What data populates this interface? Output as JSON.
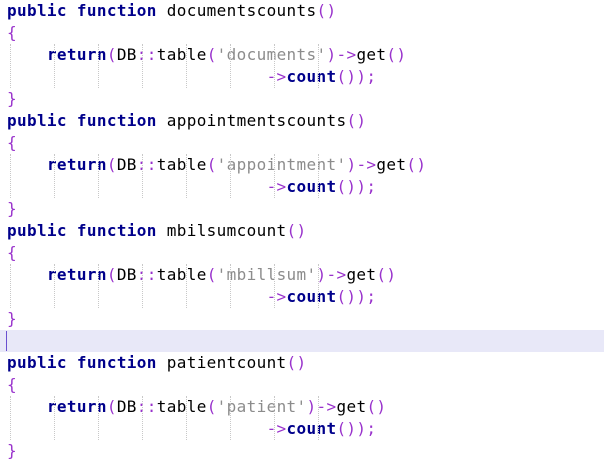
{
  "colors": {
    "background": "#ffffff",
    "keyword": "#00008b",
    "bracket_operator": "#9932cc",
    "string": "#8c8c8c",
    "current_line": "#e8e8f8"
  },
  "lines": [
    {
      "kw1": "public",
      "kw2": "function",
      "name": "documentscounts",
      "paren": "()"
    },
    {
      "brace": "{"
    },
    {
      "ret": "return",
      "p1": "(",
      "db": "DB",
      "sep": "::",
      "tbl": "table",
      "p2": "(",
      "str": "'documents'",
      "p3": ")",
      "arrow": "->",
      "get": "get",
      "p4": "()"
    },
    {
      "arrow": "->",
      "count": "count",
      "tail": "());"
    },
    {
      "brace": "}"
    },
    {
      "kw1": "public",
      "kw2": "function",
      "name": "appointmentscounts",
      "paren": "()"
    },
    {
      "brace": "{"
    },
    {
      "ret": "return",
      "p1": "(",
      "db": "DB",
      "sep": "::",
      "tbl": "table",
      "p2": "(",
      "str": "'appointment'",
      "p3": ")",
      "arrow": "->",
      "get": "get",
      "p4": "()"
    },
    {
      "arrow": "->",
      "count": "count",
      "tail": "());"
    },
    {
      "brace": "}"
    },
    {
      "kw1": "public",
      "kw2": "function",
      "name": "mbilsumcount",
      "paren": "()"
    },
    {
      "brace": "{"
    },
    {
      "ret": "return",
      "p1": "(",
      "db": "DB",
      "sep": "::",
      "tbl": "table",
      "p2": "(",
      "str": "'mbillsum'",
      "p3": ")",
      "arrow": "->",
      "get": "get",
      "p4": "()"
    },
    {
      "arrow": "->",
      "count": "count",
      "tail": "());"
    },
    {
      "brace": "}"
    },
    {
      "empty": ""
    },
    {
      "kw1": "public",
      "kw2": "function",
      "name": "patientcount",
      "paren": "()"
    },
    {
      "brace": "{"
    },
    {
      "ret": "return",
      "p1": "(",
      "db": "DB",
      "sep": "::",
      "tbl": "table",
      "p2": "(",
      "str": "'patient'",
      "p3": ")",
      "arrow": "->",
      "get": "get",
      "p4": "()"
    },
    {
      "arrow": "->",
      "count": "count",
      "tail": "());"
    },
    {
      "brace": "}"
    }
  ]
}
